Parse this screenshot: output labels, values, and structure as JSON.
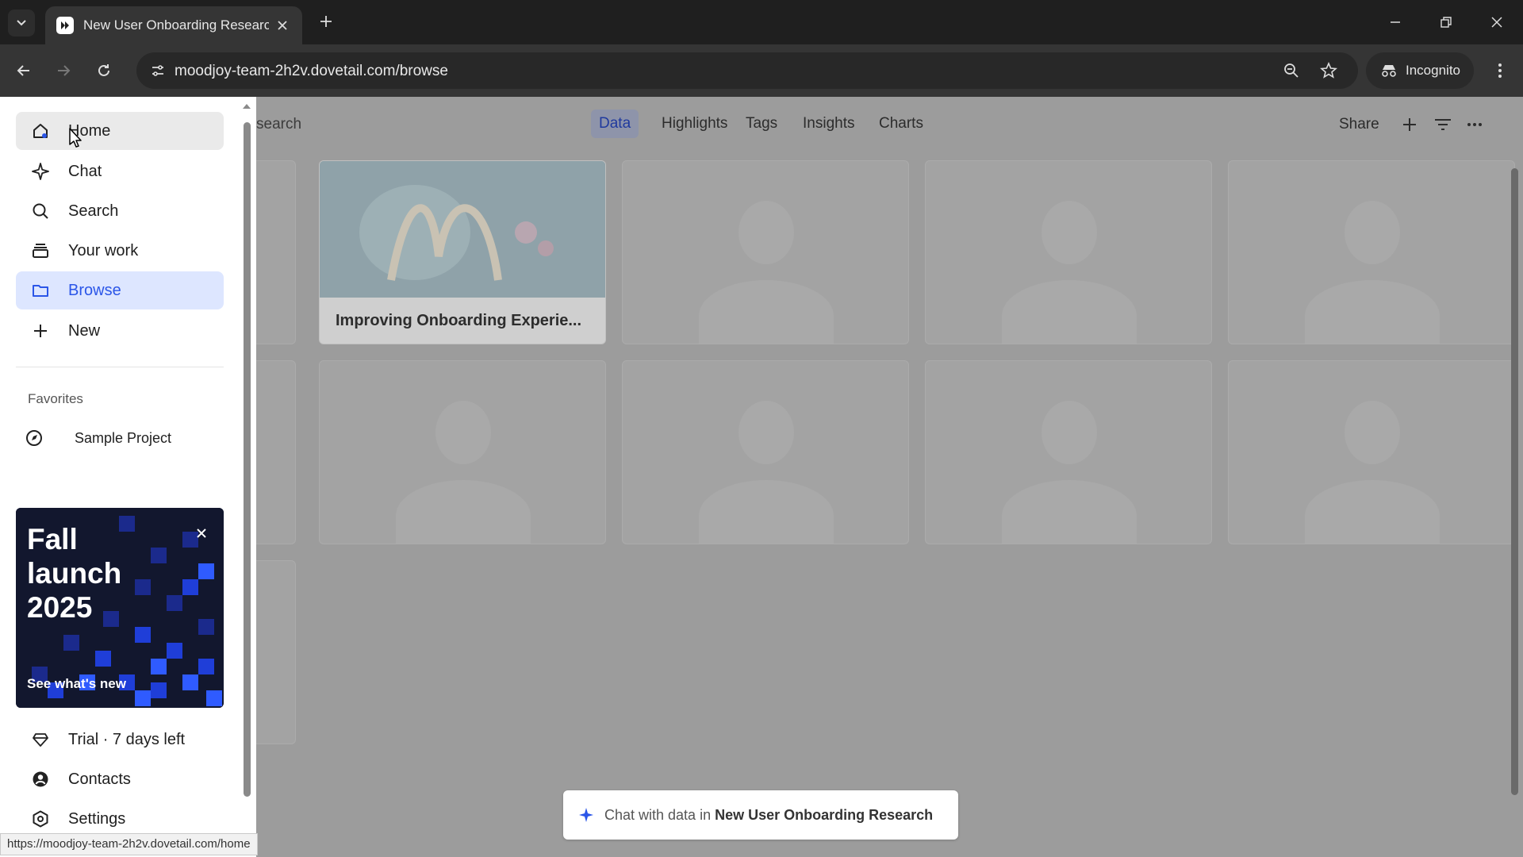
{
  "browser": {
    "tab_title": "New User Onboarding Research",
    "url": "moodjoy-team-2h2v.dovetail.com/browse",
    "incognito_label": "Incognito",
    "status_url": "https://moodjoy-team-2h2v.dovetail.com/home"
  },
  "sidebar": {
    "items": [
      {
        "label": "Home",
        "icon": "home-icon"
      },
      {
        "label": "Chat",
        "icon": "sparkle-icon"
      },
      {
        "label": "Search",
        "icon": "search-icon"
      },
      {
        "label": "Your work",
        "icon": "stack-icon"
      },
      {
        "label": "Browse",
        "icon": "folder-icon"
      },
      {
        "label": "New",
        "icon": "plus-icon"
      }
    ],
    "favorites_title": "Favorites",
    "favorites": [
      {
        "label": "Sample Project",
        "icon": "project-icon"
      }
    ],
    "promo": {
      "title": "Fall launch 2025",
      "cta": "See what's new"
    },
    "bottom_items": [
      {
        "label": "Trial · 7 days left",
        "icon": "gem-icon"
      },
      {
        "label": "Contacts",
        "icon": "contact-icon"
      },
      {
        "label": "Settings",
        "icon": "settings-icon"
      }
    ]
  },
  "main": {
    "breadcrumb_fragment": "search",
    "tabs": [
      {
        "label": "Data",
        "active": true
      },
      {
        "label": "Highlights",
        "active": false
      },
      {
        "label": "Tags",
        "active": false
      },
      {
        "label": "Insights",
        "active": false
      },
      {
        "label": "Charts",
        "active": false
      }
    ],
    "share_label": "Share",
    "feature_card_title": "Improving Onboarding Experie...",
    "chat_pill": {
      "prefix": "Chat with data in",
      "project": "New User Onboarding Research"
    }
  },
  "colors": {
    "accent": "#2b56e8",
    "active_nav_bg": "#dde6ff"
  }
}
